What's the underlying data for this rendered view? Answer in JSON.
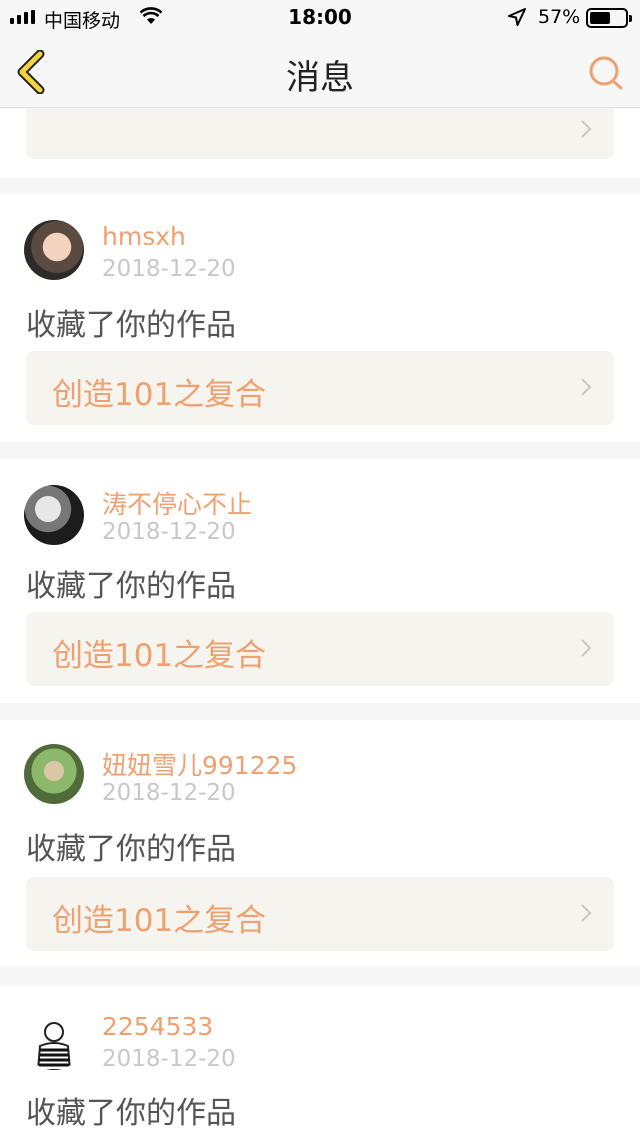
{
  "status_bar": {
    "carrier": "中国移动",
    "time": "18:00",
    "battery": "57%"
  },
  "nav": {
    "title": "消息",
    "back_icon": "chevron-left-icon",
    "search_icon": "search-icon"
  },
  "colors": {
    "accent": "#f0a070",
    "back_icon_fill": "#f2d440",
    "card_link_bg": "#f5f4ee"
  },
  "messages": [
    {
      "username": "hmsxh",
      "date": "2018-12-20",
      "action": "收藏了你的作品",
      "work_title": "创造101之复合"
    },
    {
      "username": "涛不停心不止",
      "date": "2018-12-20",
      "action": "收藏了你的作品",
      "work_title": "创造101之复合"
    },
    {
      "username": "妞妞雪儿991225",
      "date": "2018-12-20",
      "action": "收藏了你的作品",
      "work_title": "创造101之复合"
    },
    {
      "username": "2254533",
      "date": "2018-12-20",
      "action": "收藏了你的作品",
      "work_title": ""
    }
  ]
}
